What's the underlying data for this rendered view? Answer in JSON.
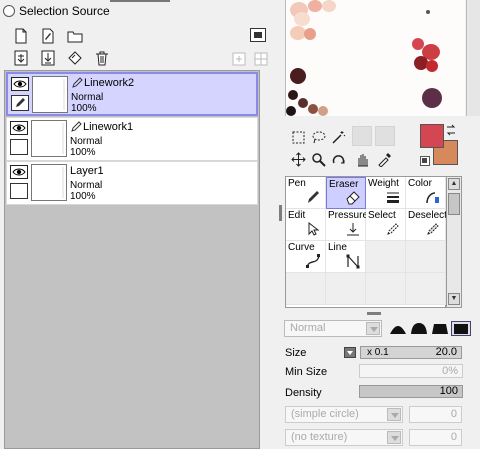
{
  "selection_source": {
    "label": "Selection Source"
  },
  "layers": [
    {
      "name": "Linework2",
      "mode": "Normal",
      "opacity": "100%",
      "selected": true
    },
    {
      "name": "Linework1",
      "mode": "Normal",
      "opacity": "100%",
      "selected": false
    },
    {
      "name": "Layer1",
      "mode": "Normal",
      "opacity": "100%",
      "selected": false
    }
  ],
  "colors": {
    "foreground": "#d44652",
    "background": "#d68a5c",
    "selection": "#d4d4ff"
  },
  "brush_tools": [
    {
      "label": "Pen",
      "icon": "pen-icon"
    },
    {
      "label": "Eraser",
      "icon": "eraser-icon",
      "selected": true
    },
    {
      "label": "Weight",
      "icon": "weight-icon"
    },
    {
      "label": "Color",
      "icon": "color-icon"
    },
    {
      "label": "Edit",
      "icon": "edit-icon"
    },
    {
      "label": "Pressure",
      "icon": "pressure-icon"
    },
    {
      "label": "Select",
      "icon": "select-icon"
    },
    {
      "label": "Deselect",
      "icon": "deselect-icon"
    },
    {
      "label": "Curve",
      "icon": "curve-icon"
    },
    {
      "label": "Line",
      "icon": "line-icon"
    }
  ],
  "brush_props": {
    "blend_mode": "Normal",
    "size_label": "Size",
    "size_multiplier": "x 0.1",
    "size_value": "20.0",
    "min_size_label": "Min Size",
    "min_size_value": "0%",
    "density_label": "Density",
    "density_value": "100",
    "shape": "(simple circle)",
    "shape_value": "0",
    "texture": "(no texture)",
    "texture_value": "0"
  }
}
